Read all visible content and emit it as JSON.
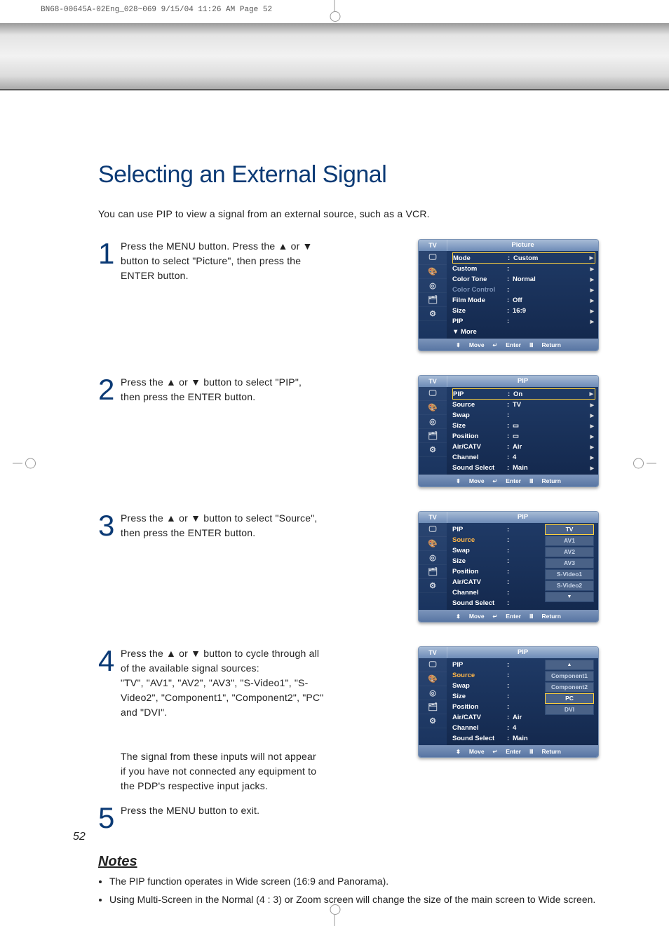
{
  "print_header": "BN68-00645A-02Eng_028~069  9/15/04  11:26 AM  Page 52",
  "title": "Selecting an External Signal",
  "intro": "You can use PIP to view a signal from an external source, such as a VCR.",
  "page_num": "52",
  "steps": [
    {
      "num": "1",
      "text": "Press the MENU button. Press the ▲ or ▼ button to select \"Picture\", then press the ENTER button."
    },
    {
      "num": "2",
      "text": "Press the ▲ or ▼ button to select \"PIP\", then press the ENTER button."
    },
    {
      "num": "3",
      "text": "Press the ▲ or ▼ button to select \"Source\", then press the ENTER button."
    },
    {
      "num": "4",
      "text": "Press the ▲ or ▼ button to cycle through all of the available signal sources:\n\"TV\", \"AV1\", \"AV2\", \"AV3\", \"S-Video1\", \"S-Video2\", \"Component1\", \"Component2\", \"PC\" and \"DVI\".\n\nThe signal from these inputs will not appear if you have not connected any equipment to the PDP's respective input jacks."
    },
    {
      "num": "5",
      "text": "Press the MENU button to exit."
    }
  ],
  "notes_heading": "Notes",
  "notes": [
    "The PIP function operates in Wide screen (16:9 and Panorama).",
    "Using Multi-Screen in the Normal (4 : 3) or Zoom screen will change the size of the main screen to Wide screen."
  ],
  "osd_footer": {
    "move": "Move",
    "enter": "Enter",
    "return": "Return"
  },
  "osd1": {
    "tv": "TV",
    "title": "Picture",
    "rows": [
      {
        "label": "Mode",
        "val": "Custom",
        "sel": true,
        "arrow": true
      },
      {
        "label": "Custom",
        "val": "",
        "arrow": true
      },
      {
        "label": "Color Tone",
        "val": "Normal",
        "arrow": true
      },
      {
        "label": "Color Control",
        "val": "",
        "dim": true,
        "arrow": true
      },
      {
        "label": "Film Mode",
        "val": "Off",
        "arrow": true
      },
      {
        "label": "Size",
        "val": "16:9",
        "arrow": true
      },
      {
        "label": "PIP",
        "val": "",
        "arrow": true
      },
      {
        "label": "▼ More",
        "val": "",
        "arrow": false,
        "nocolon": true
      }
    ]
  },
  "osd2": {
    "tv": "TV",
    "title": "PIP",
    "rows": [
      {
        "label": "PIP",
        "val": "On",
        "sel": true,
        "arrow": true
      },
      {
        "label": "Source",
        "val": "TV",
        "arrow": true
      },
      {
        "label": "Swap",
        "val": "",
        "arrow": true
      },
      {
        "label": "Size",
        "val": "▭",
        "arrow": true
      },
      {
        "label": "Position",
        "val": "▭",
        "arrow": true
      },
      {
        "label": "Air/CATV",
        "val": "Air",
        "arrow": true
      },
      {
        "label": "Channel",
        "val": "4",
        "arrow": true
      },
      {
        "label": "Sound Select",
        "val": "Main",
        "arrow": true
      }
    ]
  },
  "osd3": {
    "tv": "TV",
    "title": "PIP",
    "rows": [
      {
        "label": "PIP",
        "val": ""
      },
      {
        "label": "Source",
        "active": true,
        "val": ""
      },
      {
        "label": "Swap",
        "val": ""
      },
      {
        "label": "Size",
        "val": ""
      },
      {
        "label": "Position",
        "val": ""
      },
      {
        "label": "Air/CATV",
        "val": ""
      },
      {
        "label": "Channel",
        "val": ""
      },
      {
        "label": "Sound Select",
        "val": ""
      }
    ],
    "popup": [
      {
        "label": "TV",
        "sel": true
      },
      {
        "label": "AV1"
      },
      {
        "label": "AV2"
      },
      {
        "label": "AV3"
      },
      {
        "label": "S-Video1"
      },
      {
        "label": "S-Video2"
      },
      {
        "label": "▼",
        "arrow": true
      }
    ]
  },
  "osd4": {
    "tv": "TV",
    "title": "PIP",
    "rows": [
      {
        "label": "PIP",
        "val": ""
      },
      {
        "label": "Source",
        "active": true,
        "val": ""
      },
      {
        "label": "Swap",
        "val": ""
      },
      {
        "label": "Size",
        "val": ""
      },
      {
        "label": "Position",
        "val": ""
      },
      {
        "label": "Air/CATV",
        "val": "Air"
      },
      {
        "label": "Channel",
        "val": "4"
      },
      {
        "label": "Sound Select",
        "val": "Main"
      }
    ],
    "popup": [
      {
        "label": "▲",
        "arrow": true
      },
      {
        "label": "Component1"
      },
      {
        "label": "Component2"
      },
      {
        "label": "PC",
        "sel": true
      },
      {
        "label": "DVI"
      }
    ]
  }
}
